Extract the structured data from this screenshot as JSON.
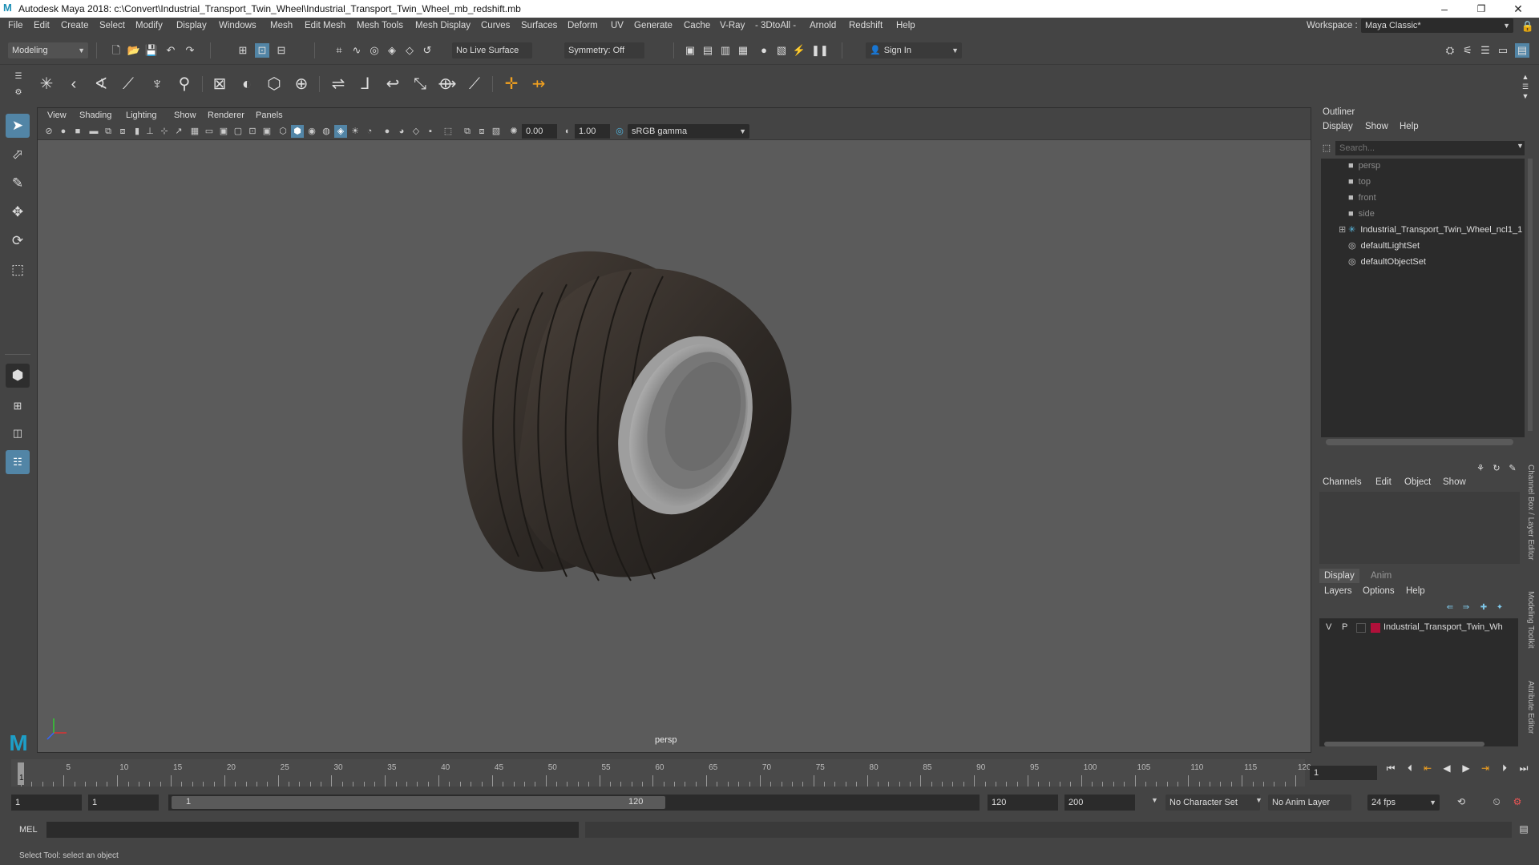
{
  "window": {
    "title": "Autodesk Maya 2018: c:\\Convert\\Industrial_Transport_Twin_Wheel\\Industrial_Transport_Twin_Wheel_mb_redshift.mb",
    "minimize": "–",
    "maximize": "❐",
    "close": "✕"
  },
  "menubar": {
    "items": [
      "File",
      "Edit",
      "Create",
      "Select",
      "Modify",
      "Display",
      "Windows",
      "Mesh",
      "Edit Mesh",
      "Mesh Tools",
      "Mesh Display",
      "Curves",
      "Surfaces",
      "Deform",
      "UV",
      "Generate",
      "Cache",
      "V-Ray",
      "- 3DtoAll -",
      "Arnold",
      "Redshift",
      "Help"
    ],
    "workspace_label": "Workspace :",
    "workspace_value": "Maya Classic*"
  },
  "statusline": {
    "mode": "Modeling",
    "live_surface": "No Live Surface",
    "symmetry": "Symmetry: Off",
    "sign_in": "Sign In"
  },
  "viewport": {
    "menus": [
      "View",
      "Shading",
      "Lighting",
      "Show",
      "Renderer",
      "Panels"
    ],
    "exposure": "0.00",
    "gamma": "1.00",
    "color_space": "sRGB gamma",
    "camera_label": "persp"
  },
  "outliner": {
    "title": "Outliner",
    "menus": [
      "Display",
      "Show",
      "Help"
    ],
    "search_placeholder": "Search...",
    "items": [
      {
        "label": "persp",
        "icon": "camera-icon",
        "dim": true
      },
      {
        "label": "top",
        "icon": "camera-icon",
        "dim": true
      },
      {
        "label": "front",
        "icon": "camera-icon",
        "dim": true
      },
      {
        "label": "side",
        "icon": "camera-icon",
        "dim": true
      },
      {
        "label": "Industrial_Transport_Twin_Wheel_ncl1_1",
        "icon": "group-icon",
        "dim": false
      },
      {
        "label": "defaultLightSet",
        "icon": "set-icon",
        "dim": false
      },
      {
        "label": "defaultObjectSet",
        "icon": "set-icon",
        "dim": false
      }
    ]
  },
  "channelbox": {
    "menus": [
      "Channels",
      "Edit",
      "Object",
      "Show"
    ]
  },
  "layers": {
    "tabs": [
      "Display",
      "Anim"
    ],
    "menus": [
      "Layers",
      "Options",
      "Help"
    ],
    "layer_v": "V",
    "layer_p": "P",
    "layer_name": "Industrial_Transport_Twin_Wh",
    "layer_color": "#b0103a"
  },
  "side_tabs": [
    "Channel Box / Layer Editor",
    "Modeling Toolkit",
    "Attribute Editor"
  ],
  "timeline": {
    "ticks": [
      "5",
      "10",
      "15",
      "20",
      "25",
      "30",
      "35",
      "40",
      "45",
      "50",
      "55",
      "60",
      "65",
      "70",
      "75",
      "80",
      "85",
      "90",
      "95",
      "100",
      "105",
      "110",
      "115",
      "120"
    ],
    "start_marker": "1",
    "current_frame": "1"
  },
  "range": {
    "start": "1",
    "anim_start": "1",
    "slider_start": "1",
    "slider_end": "120",
    "anim_end": "120",
    "end": "200",
    "character_set": "No Character Set",
    "anim_layer": "No Anim Layer",
    "fps": "24 fps"
  },
  "cmdline": {
    "label": "MEL"
  },
  "helpline": {
    "text": "Select Tool: select an object"
  }
}
